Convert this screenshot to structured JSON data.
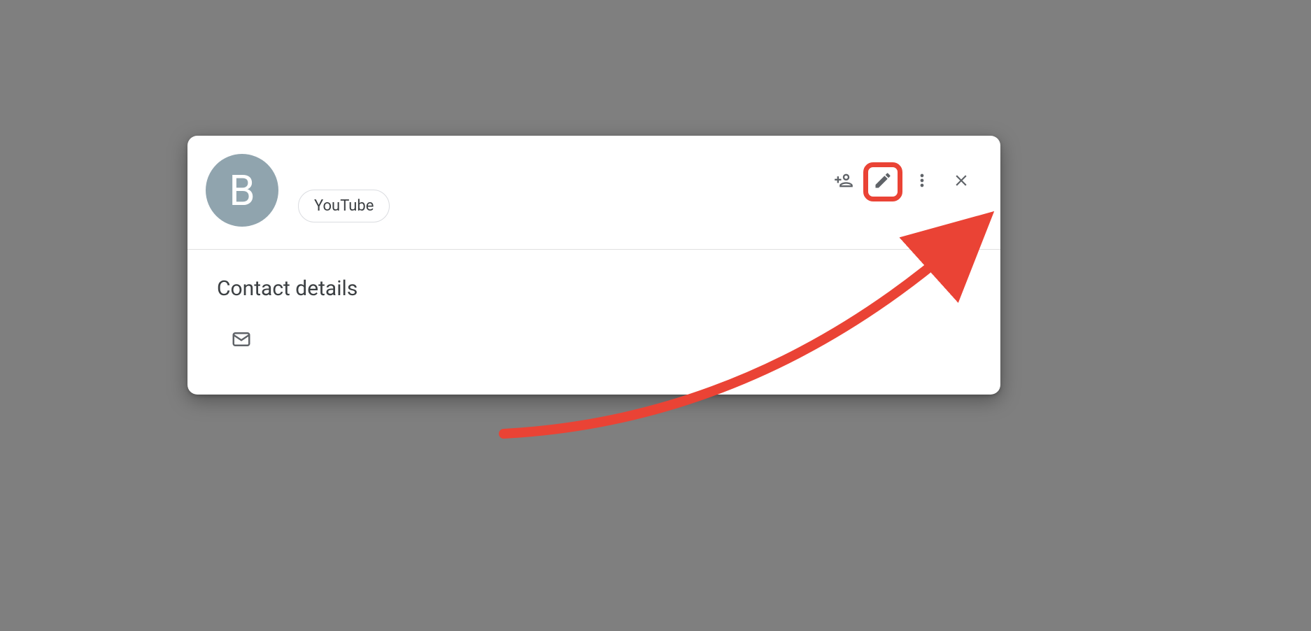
{
  "header": {
    "avatar_initial": "B",
    "chip_label": "YouTube"
  },
  "details": {
    "section_title": "Contact details"
  },
  "annotation": {
    "highlight_color": "#ea4335"
  }
}
